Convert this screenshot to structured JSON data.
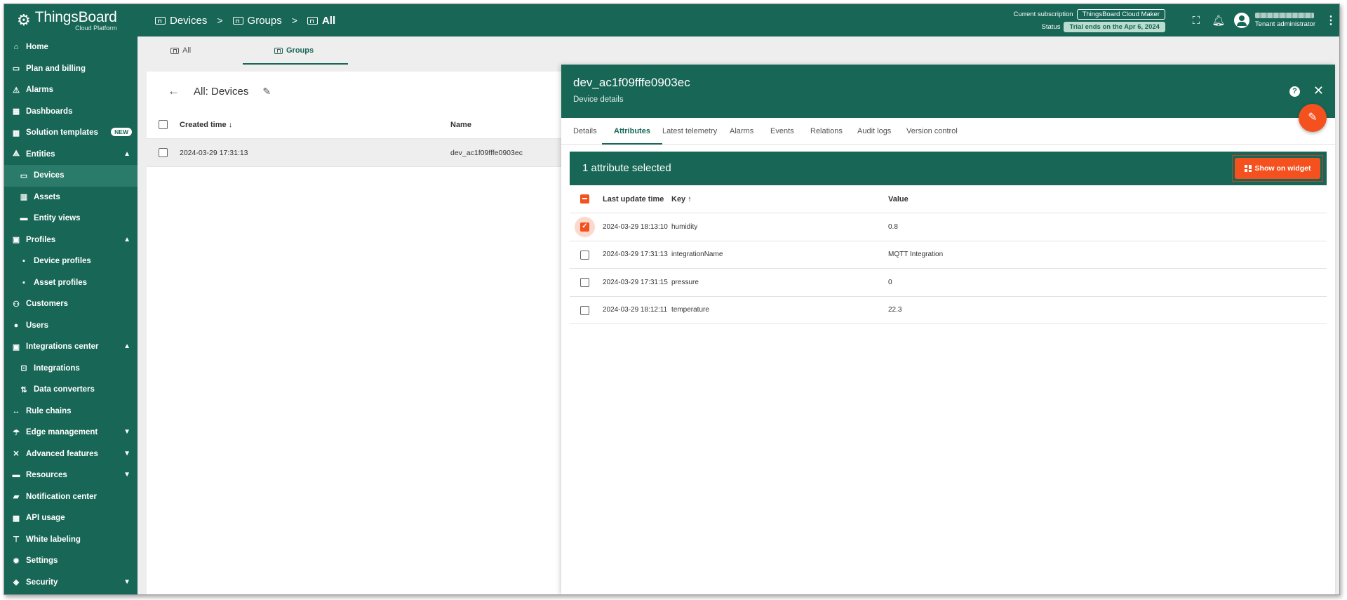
{
  "topbar": {
    "brand": "ThingsBoard",
    "brand_sub": "Cloud Platform",
    "breadcrumb": [
      "Devices",
      "Groups",
      "All"
    ],
    "subscription_label": "Current subscription",
    "subscription_value": "ThingsBoard Cloud Maker",
    "status_label": "Status",
    "status_value": "Trial ends on the Apr 6, 2024",
    "user_role": "Tenant administrator"
  },
  "sidebar": {
    "items": [
      {
        "label": "Home",
        "icon": "home-icon"
      },
      {
        "label": "Plan and billing",
        "icon": "billing-icon"
      },
      {
        "label": "Alarms",
        "icon": "alarm-icon"
      },
      {
        "label": "Dashboards",
        "icon": "dashboard-icon"
      },
      {
        "label": "Solution templates",
        "icon": "templates-icon",
        "badge": "NEW"
      },
      {
        "label": "Entities",
        "icon": "entities-icon",
        "expanded": true
      },
      {
        "label": "Devices",
        "icon": "device-icon",
        "child": true,
        "active": true
      },
      {
        "label": "Assets",
        "icon": "asset-icon",
        "child": true
      },
      {
        "label": "Entity views",
        "icon": "entity-view-icon",
        "child": true
      },
      {
        "label": "Profiles",
        "icon": "profiles-icon",
        "expanded": true
      },
      {
        "label": "Device profiles",
        "icon": "device-profile-icon",
        "child": true
      },
      {
        "label": "Asset profiles",
        "icon": "asset-profile-icon",
        "child": true
      },
      {
        "label": "Customers",
        "icon": "customers-icon"
      },
      {
        "label": "Users",
        "icon": "users-icon"
      },
      {
        "label": "Integrations center",
        "icon": "integrations-center-icon",
        "expanded": true
      },
      {
        "label": "Integrations",
        "icon": "integrations-icon",
        "child": true
      },
      {
        "label": "Data converters",
        "icon": "converter-icon",
        "child": true
      },
      {
        "label": "Rule chains",
        "icon": "rule-chain-icon"
      },
      {
        "label": "Edge management",
        "icon": "edge-icon",
        "collapsed": true
      },
      {
        "label": "Advanced features",
        "icon": "advanced-icon",
        "collapsed": true
      },
      {
        "label": "Resources",
        "icon": "resources-icon",
        "collapsed": true
      },
      {
        "label": "Notification center",
        "icon": "notification-icon"
      },
      {
        "label": "API usage",
        "icon": "api-icon"
      },
      {
        "label": "White labeling",
        "icon": "white-label-icon"
      },
      {
        "label": "Settings",
        "icon": "settings-icon"
      },
      {
        "label": "Security",
        "icon": "security-icon",
        "collapsed": true
      }
    ]
  },
  "toptabs": [
    "All",
    "Groups"
  ],
  "list": {
    "title": "All: Devices",
    "col_created": "Created time",
    "col_name": "Name",
    "rows": [
      {
        "created": "2024-03-29 17:31:13",
        "name": "dev_ac1f09fffe0903ec"
      }
    ]
  },
  "details": {
    "title": "dev_ac1f09fffe0903ec",
    "subtitle": "Device details",
    "tabs": [
      "Details",
      "Attributes",
      "Latest telemetry",
      "Alarms",
      "Events",
      "Relations",
      "Audit logs",
      "Version control"
    ],
    "active_tab": "Attributes",
    "selection_text": "1 attribute selected",
    "show_widget_label": "Show on widget",
    "columns": {
      "time": "Last update time",
      "key": "Key",
      "value": "Value"
    },
    "rows": [
      {
        "time": "2024-03-29 18:13:10",
        "key": "humidity",
        "value": "0.8",
        "checked": true
      },
      {
        "time": "2024-03-29 17:31:13",
        "key": "integrationName",
        "value": "MQTT Integration",
        "checked": false
      },
      {
        "time": "2024-03-29 17:31:15",
        "key": "pressure",
        "value": "0",
        "checked": false
      },
      {
        "time": "2024-03-29 18:12:11",
        "key": "temperature",
        "value": "22.3",
        "checked": false
      }
    ]
  },
  "colors": {
    "primary": "#176656",
    "accent": "#f4511e"
  }
}
